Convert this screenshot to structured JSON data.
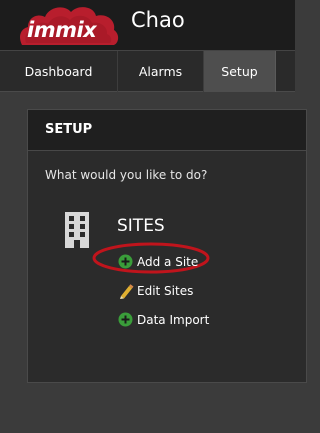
{
  "header": {
    "logo_text": "immix",
    "username": "Chao",
    "brand_color": "#b81e2d"
  },
  "nav": {
    "tabs": [
      {
        "label": "Dashboard",
        "active": false
      },
      {
        "label": "Alarms",
        "active": false
      },
      {
        "label": "Setup",
        "active": true
      }
    ]
  },
  "panel": {
    "title": "SETUP",
    "prompt": "What would you like to do?",
    "section": {
      "icon": "building-icon",
      "title": "SITES",
      "actions": [
        {
          "label": "Add a Site",
          "icon": "plus-circle-icon",
          "highlighted": true
        },
        {
          "label": "Edit Sites",
          "icon": "pencil-icon"
        },
        {
          "label": "Data Import",
          "icon": "plus-circle-icon"
        }
      ]
    }
  },
  "colors": {
    "action_green": "#3a9d3a",
    "highlight_red": "#c0141c"
  }
}
